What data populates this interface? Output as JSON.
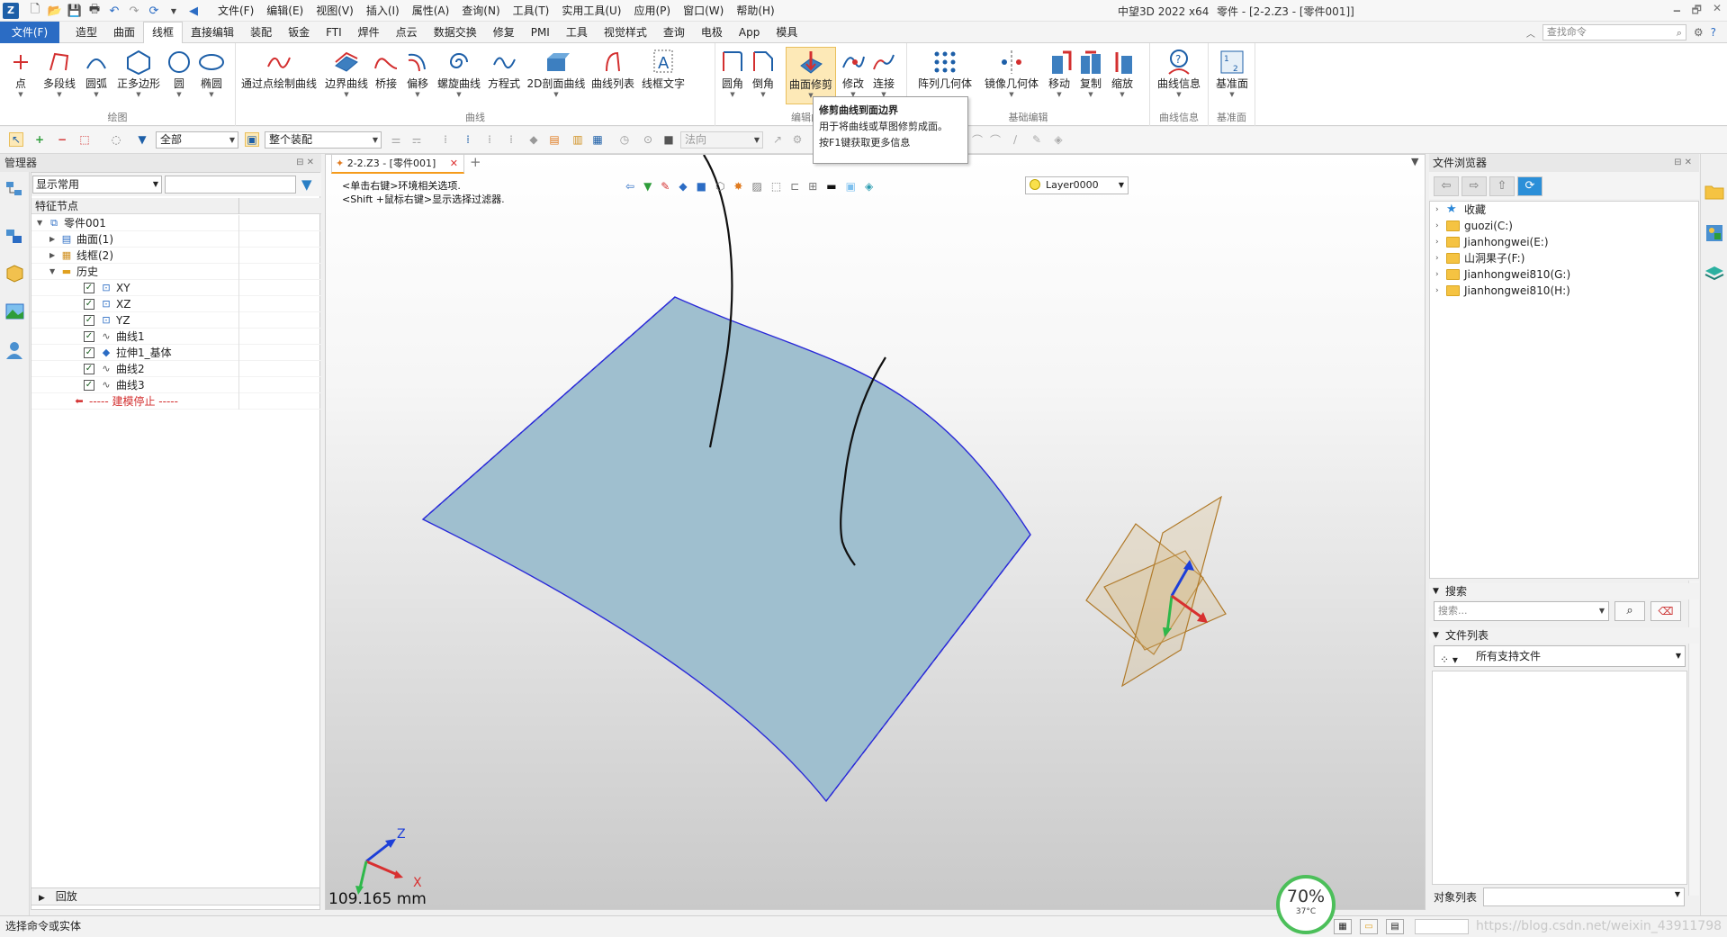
{
  "titlebar": {
    "menus": [
      "文件(F)",
      "编辑(E)",
      "视图(V)",
      "插入(I)",
      "属性(A)",
      "查询(N)",
      "工具(T)",
      "实用工具(U)",
      "应用(P)",
      "窗口(W)",
      "帮助(H)"
    ],
    "app_name": "中望3D 2022 x64",
    "doc_title": "零件 - [2-2.Z3 - [零件001]]"
  },
  "ribbon_tabs": {
    "file": "文件(F)",
    "tabs": [
      "造型",
      "曲面",
      "线框",
      "直接编辑",
      "装配",
      "钣金",
      "FTI",
      "焊件",
      "点云",
      "数据交换",
      "修复",
      "PMI",
      "工具",
      "视觉样式",
      "查询",
      "电极",
      "App",
      "模具"
    ],
    "active": "线框",
    "search_placeholder": "查找命令"
  },
  "ribbon": {
    "groups": {
      "draw": "绘图",
      "curve": "曲线",
      "edit": "编辑曲线",
      "basic_edit": "基础编辑",
      "curve_info": "曲线信息",
      "datum": "基准面"
    },
    "buttons": {
      "point": "点",
      "polyline": "多段线",
      "arc": "圆弧",
      "polygon": "正多边形",
      "circle": "圆",
      "ellipse": "椭圆",
      "through_points": "通过点绘制曲线",
      "boundary": "边界曲线",
      "bridge": "桥接",
      "offset": "偏移",
      "helix": "螺旋曲线",
      "equation": "方程式",
      "section2d": "2D剖面曲线",
      "curve_list": "曲线列表",
      "curve_text": "线框文字",
      "fillet": "圆角",
      "chamfer": "倒角",
      "surface_trim": "曲面修剪",
      "modify": "修改",
      "connect": "连接",
      "pattern": "阵列几何体",
      "mirror": "镜像几何体",
      "move": "移动",
      "copy": "复制",
      "scale": "缩放",
      "curve_info": "曲线信息",
      "datum_plane": "基准面"
    }
  },
  "tooltip": {
    "title": "修剪曲线到面边界",
    "desc": "用于将曲线或草图修剪成面。",
    "help": "按F1键获取更多信息"
  },
  "toolbar": {
    "filter": "全部",
    "scope": "整个装配",
    "normal": "法向"
  },
  "manager": {
    "title": "管理器",
    "display": "显示常用",
    "column": "特征节点",
    "tree": [
      {
        "label": "零件001",
        "indent": 0,
        "twisty": "open",
        "icon": "part-icon",
        "check": false
      },
      {
        "label": "曲面(1)",
        "indent": 1,
        "twisty": "closed",
        "icon": "surface-folder-icon",
        "check": false
      },
      {
        "label": "线框(2)",
        "indent": 1,
        "twisty": "closed",
        "icon": "wireframe-folder-icon",
        "check": false
      },
      {
        "label": "历史",
        "indent": 1,
        "twisty": "open",
        "icon": "folder-icon",
        "check": false
      },
      {
        "label": "XY",
        "indent": 2,
        "twisty": "none",
        "icon": "plane-icon",
        "check": true
      },
      {
        "label": "XZ",
        "indent": 2,
        "twisty": "none",
        "icon": "plane-icon",
        "check": true
      },
      {
        "label": "YZ",
        "indent": 2,
        "twisty": "none",
        "icon": "plane-icon",
        "check": true
      },
      {
        "label": "曲线1",
        "indent": 2,
        "twisty": "none",
        "icon": "curve-icon",
        "check": true
      },
      {
        "label": "拉伸1_基体",
        "indent": 2,
        "twisty": "none",
        "icon": "extrude-icon",
        "check": true
      },
      {
        "label": "曲线2",
        "indent": 2,
        "twisty": "none",
        "icon": "curve-icon",
        "check": true
      },
      {
        "label": "曲线3",
        "indent": 2,
        "twisty": "none",
        "icon": "curve-icon",
        "check": true
      },
      {
        "label": "----- 建模停止 -----",
        "indent": 2,
        "twisty": "none",
        "icon": "stop-arrow-icon",
        "check": false
      }
    ],
    "footer": "回放"
  },
  "viewport": {
    "doc_tab": "2-2.Z3 - [零件001]",
    "hint1": "<单击右键>环境相关选项.",
    "hint2": "<Shift +鼠标右键>显示选择过滤器.",
    "layer": "Layer0000",
    "scale": "109.165 mm",
    "axis_x": "X",
    "axis_z": "Z"
  },
  "filebrowser": {
    "title": "文件浏览器",
    "items": [
      {
        "label": "收藏",
        "icon": "star-icon"
      },
      {
        "label": "guozi(C:)",
        "icon": "folder-icon"
      },
      {
        "label": "Jianhongwei(E:)",
        "icon": "folder-icon"
      },
      {
        "label": "山洞果子(F:)",
        "icon": "folder-icon"
      },
      {
        "label": "Jianhongwei810(G:)",
        "icon": "folder-icon"
      },
      {
        "label": "Jianhongwei810(H:)",
        "icon": "folder-icon"
      }
    ],
    "search_section": "搜索",
    "search_placeholder": "搜索...",
    "list_section": "文件列表",
    "file_type": "所有支持文件",
    "object_list": "对象列表"
  },
  "status": {
    "text": "选择命令或实体",
    "watermark": "https://blog.csdn.net/weixin_43911798"
  },
  "gauge": {
    "percent": "70%",
    "temp": "37°C"
  },
  "colors": {
    "accent": "#2b6cc4",
    "surface_fill": "#9fbfcf",
    "surface_edge": "#2a2ad8",
    "ribbon_highlight": "#fde9b7"
  }
}
